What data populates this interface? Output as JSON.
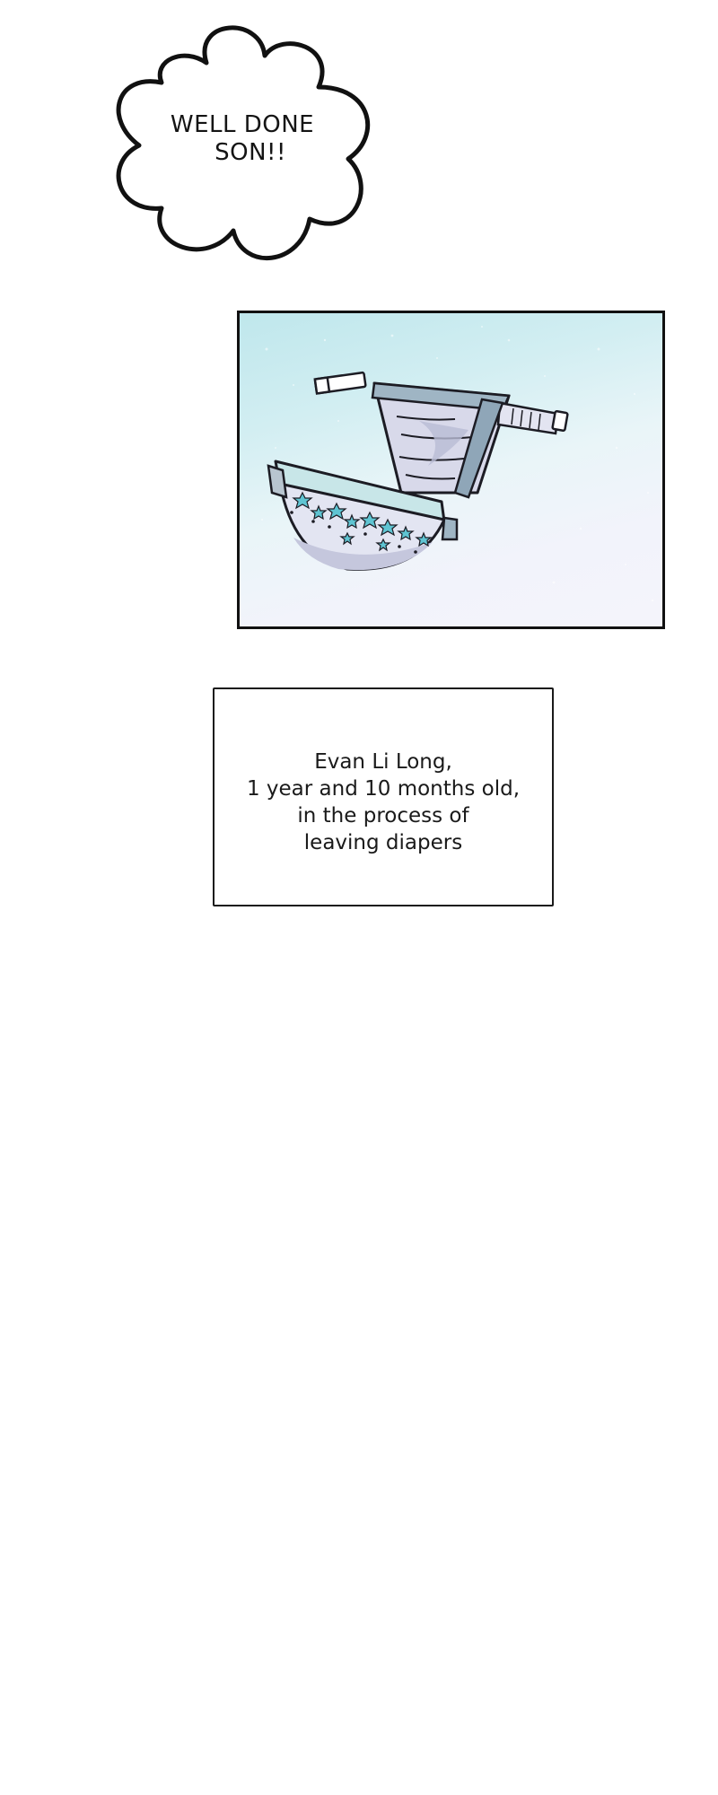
{
  "speech_bubble": {
    "lines": [
      "WELL DONE",
      "SON!!"
    ]
  },
  "illustration": {
    "subject": "diaper",
    "colors": {
      "sky_top": "#bfe7ec",
      "sky_bottom": "#f4f4fb",
      "diaper_body": "#c9cbe0",
      "diaper_trim": "#9ec9d0",
      "star_accent": "#5fc4d2",
      "outline": "#1c1c24"
    }
  },
  "caption": {
    "lines": [
      "Evan Li Long,",
      "1 year and 10 months old,",
      "in the process of",
      "leaving diapers"
    ]
  }
}
